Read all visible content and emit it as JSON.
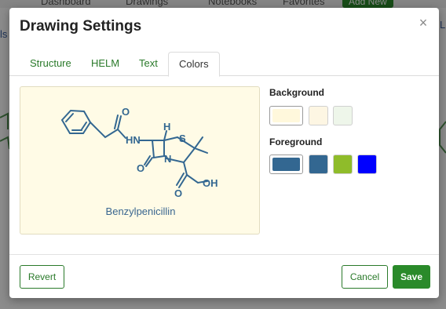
{
  "background_app": {
    "nav": [
      "Dashboard",
      "Drawings",
      "Notebooks",
      "Favorites"
    ],
    "add_new_label": "Add New",
    "side_left": "ls",
    "side_right": "Li"
  },
  "dialog": {
    "title": "Drawing Settings",
    "close_glyph": "×",
    "tabs": [
      {
        "label": "Structure",
        "active": false
      },
      {
        "label": "HELM",
        "active": false
      },
      {
        "label": "Text",
        "active": false
      },
      {
        "label": "Colors",
        "active": true
      }
    ],
    "preview": {
      "molecule_name": "Benzylpenicillin",
      "atoms": {
        "o1": "O",
        "hn": "HN",
        "h": "H",
        "s": "S",
        "n": "N",
        "o2": "O",
        "o3": "O",
        "oh": "OH"
      }
    },
    "background": {
      "label": "Background",
      "swatches": [
        {
          "color": "#fff8dc",
          "selected": true
        },
        {
          "color": "#fdf6e3",
          "selected": false
        },
        {
          "color": "#eef6ea",
          "selected": false
        }
      ]
    },
    "foreground": {
      "label": "Foreground",
      "swatches": [
        {
          "color": "#336791",
          "selected": true
        },
        {
          "color": "#336791",
          "selected": false
        },
        {
          "color": "#8fbc2a",
          "selected": false
        },
        {
          "color": "#0000ff",
          "selected": false
        }
      ]
    },
    "footer": {
      "revert_label": "Revert",
      "cancel_label": "Cancel",
      "save_label": "Save"
    }
  },
  "colors": {
    "accent": "#2a8a2a",
    "molecule": "#336791"
  }
}
